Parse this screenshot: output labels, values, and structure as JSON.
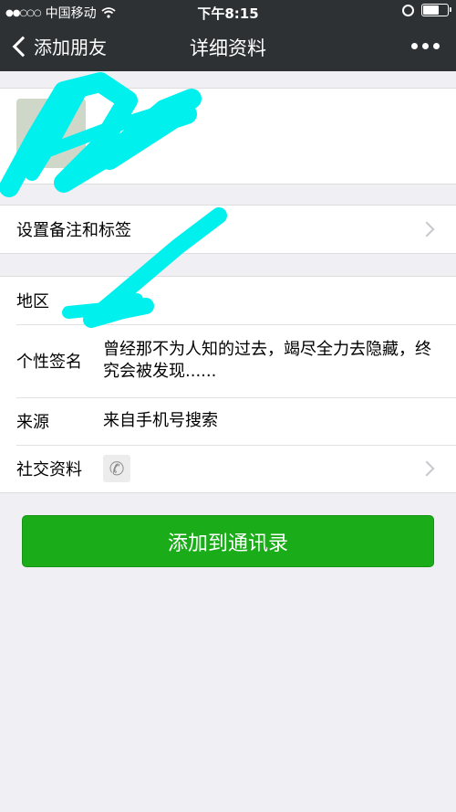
{
  "status_bar": {
    "signal": "●●○○○",
    "carrier": "中国移动",
    "time": "下午8:15"
  },
  "nav": {
    "back_label": "添加朋友",
    "title": "详细资料"
  },
  "remark_row": {
    "label": "设置备注和标签"
  },
  "info": {
    "region": {
      "label": "地区",
      "value": ""
    },
    "signature": {
      "label": "个性签名",
      "value": "曾经那不为人知的过去，竭尽全力去隐藏，终究会被发现......"
    },
    "source": {
      "label": "来源",
      "value": "来自手机号搜索"
    },
    "social": {
      "label": "社交资料"
    }
  },
  "add_button": {
    "label": "添加到通讯录"
  },
  "colors": {
    "nav_bg": "#2e3134",
    "page_bg": "#efeff4",
    "button_green": "#1aad19",
    "redaction_cyan": "#00f0ee"
  },
  "icons": [
    "wifi-icon",
    "lock-rotation-icon",
    "battery-icon",
    "chevron-left-icon",
    "more-icon",
    "chevron-right-icon",
    "phone-icon"
  ]
}
